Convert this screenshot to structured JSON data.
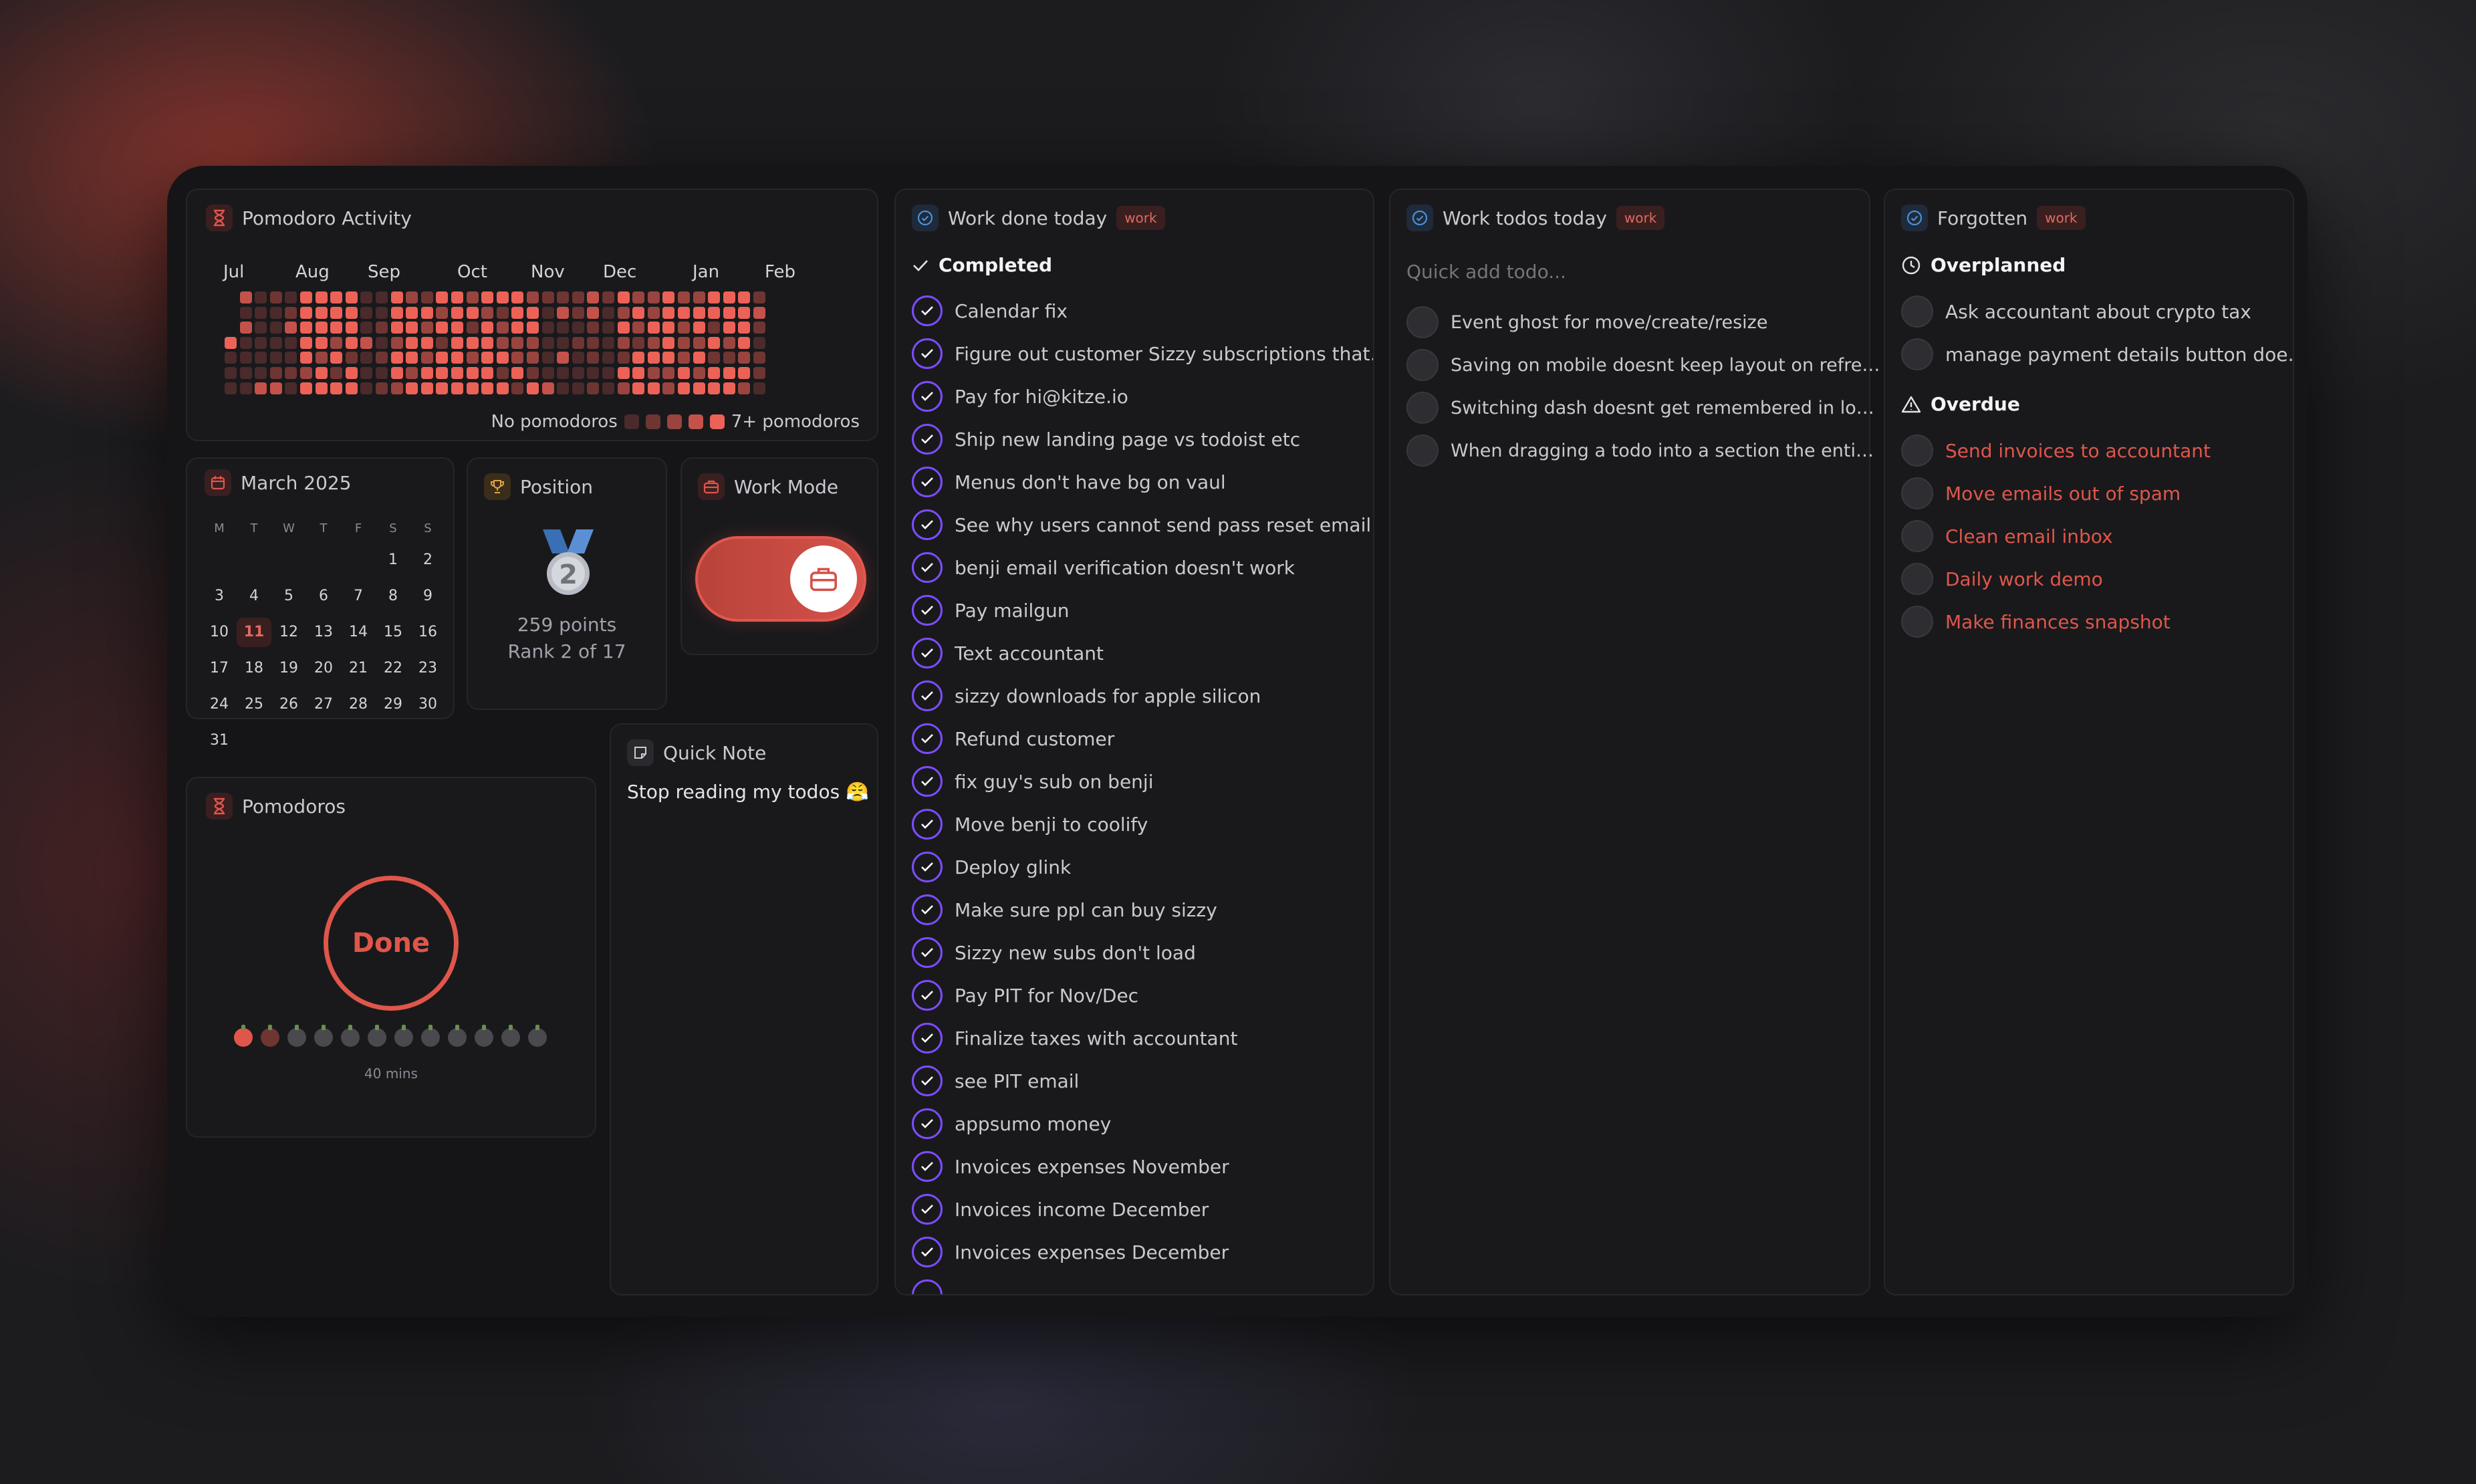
{
  "colors": {
    "accent_red": "#e0564a",
    "accent_purple": "#7c4dff",
    "accent_blue": "#4a90d9"
  },
  "activity": {
    "title": "Pomodoro Activity",
    "months": [
      "Jul",
      "Aug",
      "Sep",
      "Oct",
      "Nov",
      "Dec",
      "Jan",
      "Feb"
    ],
    "legend_low": "No pomodoros",
    "legend_high": "7+ pomodoros"
  },
  "calendar": {
    "title": "March 2025",
    "weekdays": [
      "M",
      "T",
      "W",
      "T",
      "F",
      "S",
      "S"
    ],
    "today": "11",
    "days": [
      "",
      "",
      "",
      "",
      "",
      "1",
      "2",
      "3",
      "4",
      "5",
      "6",
      "7",
      "8",
      "9",
      "10",
      "11",
      "12",
      "13",
      "14",
      "15",
      "16",
      "17",
      "18",
      "19",
      "20",
      "21",
      "22",
      "23",
      "24",
      "25",
      "26",
      "27",
      "28",
      "29",
      "30",
      "31"
    ]
  },
  "position": {
    "title": "Position",
    "medal_number": "2",
    "points": "259 points",
    "rank": "Rank 2 of 17"
  },
  "work_mode": {
    "title": "Work Mode",
    "enabled": true
  },
  "pomodoros": {
    "title": "Pomodoros",
    "status": "Done",
    "duration": "40 mins",
    "completed": 2,
    "total": 12
  },
  "quick_note": {
    "title": "Quick Note",
    "text": "Stop reading my todos 😤"
  },
  "work_done": {
    "title": "Work done today",
    "tag": "work",
    "section": "Completed",
    "items": [
      "Calendar fix",
      "Figure out customer Sizzy subscriptions that…",
      "Pay for hi@kitze.io",
      "Ship new landing page vs todoist etc",
      "Menus don't have bg on vaul",
      "See why users cannot send pass reset email …",
      "benji email verification doesn't work",
      "Pay mailgun",
      "Text accountant",
      "sizzy downloads for apple silicon",
      "Refund customer",
      "fix guy's sub on benji",
      "Move benji to coolify",
      "Deploy glink",
      "Make sure ppl can buy sizzy",
      "Sizzy new subs don't load",
      "Pay PIT for Nov/Dec",
      "Finalize taxes with accountant",
      "see PIT email",
      "appsumo money",
      "Invoices expenses November",
      "Invoices income December",
      "Invoices expenses December"
    ]
  },
  "work_todos": {
    "title": "Work todos today",
    "tag": "work",
    "placeholder": "Quick add todo...",
    "items": [
      "Event ghost for move/create/resize",
      "Saving on mobile doesnt keep layout on refre…",
      "Switching dash doesnt get remembered in lo…",
      "When dragging a todo into a section the enti…"
    ]
  },
  "forgotten": {
    "title": "Forgotten",
    "tag": "work",
    "overplanned_label": "Overplanned",
    "overplanned": [
      "Ask accountant about crypto tax",
      "manage payment details button doe…"
    ],
    "overdue_label": "Overdue",
    "overdue": [
      "Send invoices to accountant",
      "Move emails out of spam",
      "Clean email inbox",
      "Daily work demo",
      "Make finances snapshot"
    ]
  }
}
